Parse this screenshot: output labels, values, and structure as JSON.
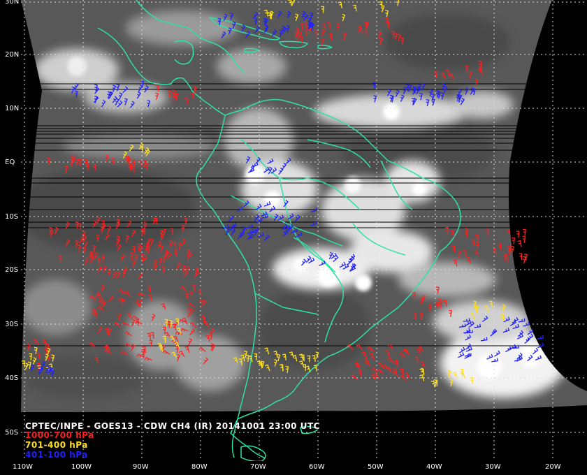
{
  "map": {
    "title": "CPTEC/INPE - GOES13 - CDW CH4 (IR) 20141001 23:00 UTC",
    "lat_labels": [
      "30N",
      "20N",
      "10N",
      "EQ",
      "10S",
      "20S",
      "30S",
      "40S",
      "50S"
    ],
    "lon_labels": [
      "110W",
      "100W",
      "90W",
      "80W",
      "70W",
      "60W",
      "50W",
      "40W",
      "30W",
      "20W"
    ],
    "colors": {
      "background": "#000000",
      "cloud_base": "#555555",
      "graticule": "#dddddd",
      "coastline": "#2fe0a8",
      "wind_low": "#ff2020",
      "wind_mid": "#ffe020",
      "wind_high": "#2020ff"
    }
  },
  "legend": {
    "items": [
      {
        "label": "1000-700 hPa",
        "color": "#ff2020"
      },
      {
        "label": "701-400 hPa",
        "color": "#ffe020"
      },
      {
        "label": "401-100 hPa",
        "color": "#2020ff"
      }
    ]
  }
}
